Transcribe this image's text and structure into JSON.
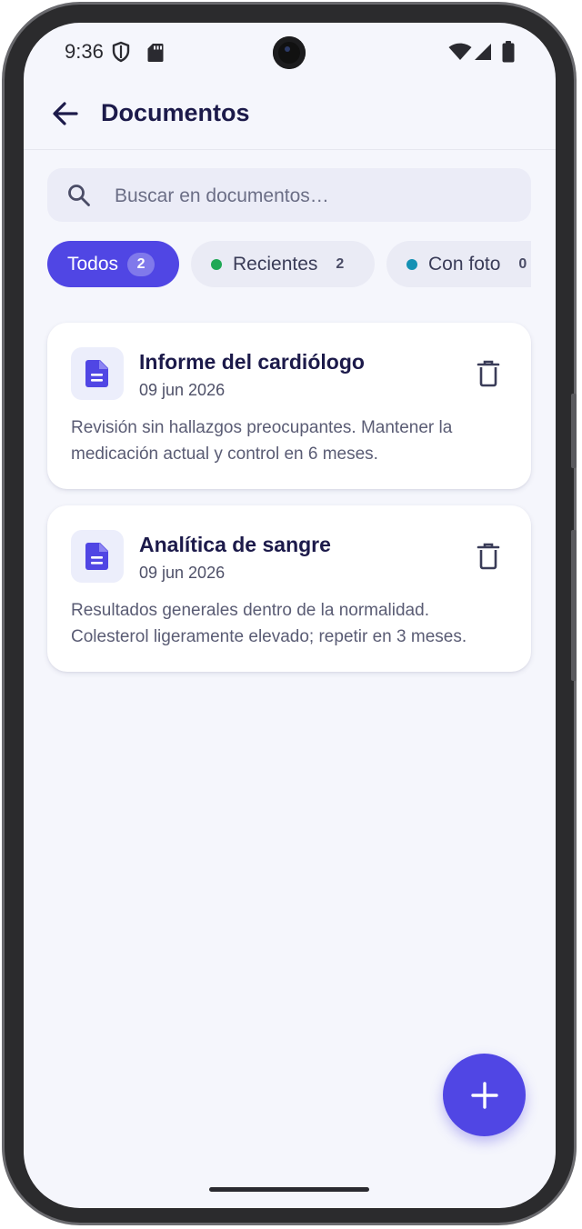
{
  "status_bar": {
    "time": "9:36",
    "icons": [
      "shield-icon",
      "sd-card-icon",
      "wifi-icon",
      "cell-signal-icon",
      "battery-icon"
    ]
  },
  "app_bar": {
    "title": "Documentos",
    "back_icon": "arrow-left-icon"
  },
  "search": {
    "placeholder": "Buscar en documentos…",
    "value": ""
  },
  "filters": [
    {
      "label": "Todos",
      "count": "2",
      "active": true
    },
    {
      "label": "Recientes",
      "count": "2",
      "active": false,
      "dot_color": "#1fa855"
    },
    {
      "label": "Con foto",
      "count": "0",
      "active": false,
      "dot_color": "#1591b4"
    }
  ],
  "documents": [
    {
      "title": "Informe del cardiólogo",
      "date": "09 jun 2026",
      "description": "Revisión sin hallazgos preocupantes. Mantener la medicación actual y control en 6 meses.",
      "icon": "document-icon"
    },
    {
      "title": "Analítica de sangre",
      "date": "09 jun 2026",
      "description": "Resultados generales dentro de la normalidad. Colesterol ligeramente elevado; repetir en 3 meses.",
      "icon": "document-icon"
    }
  ],
  "fab": {
    "icon": "plus-icon"
  },
  "colors": {
    "accent": "#5046e4",
    "background": "#f5f6fc",
    "title_text": "#1c1a4a",
    "dot_recientes": "#1fa855",
    "dot_con_foto": "#1591b4"
  }
}
